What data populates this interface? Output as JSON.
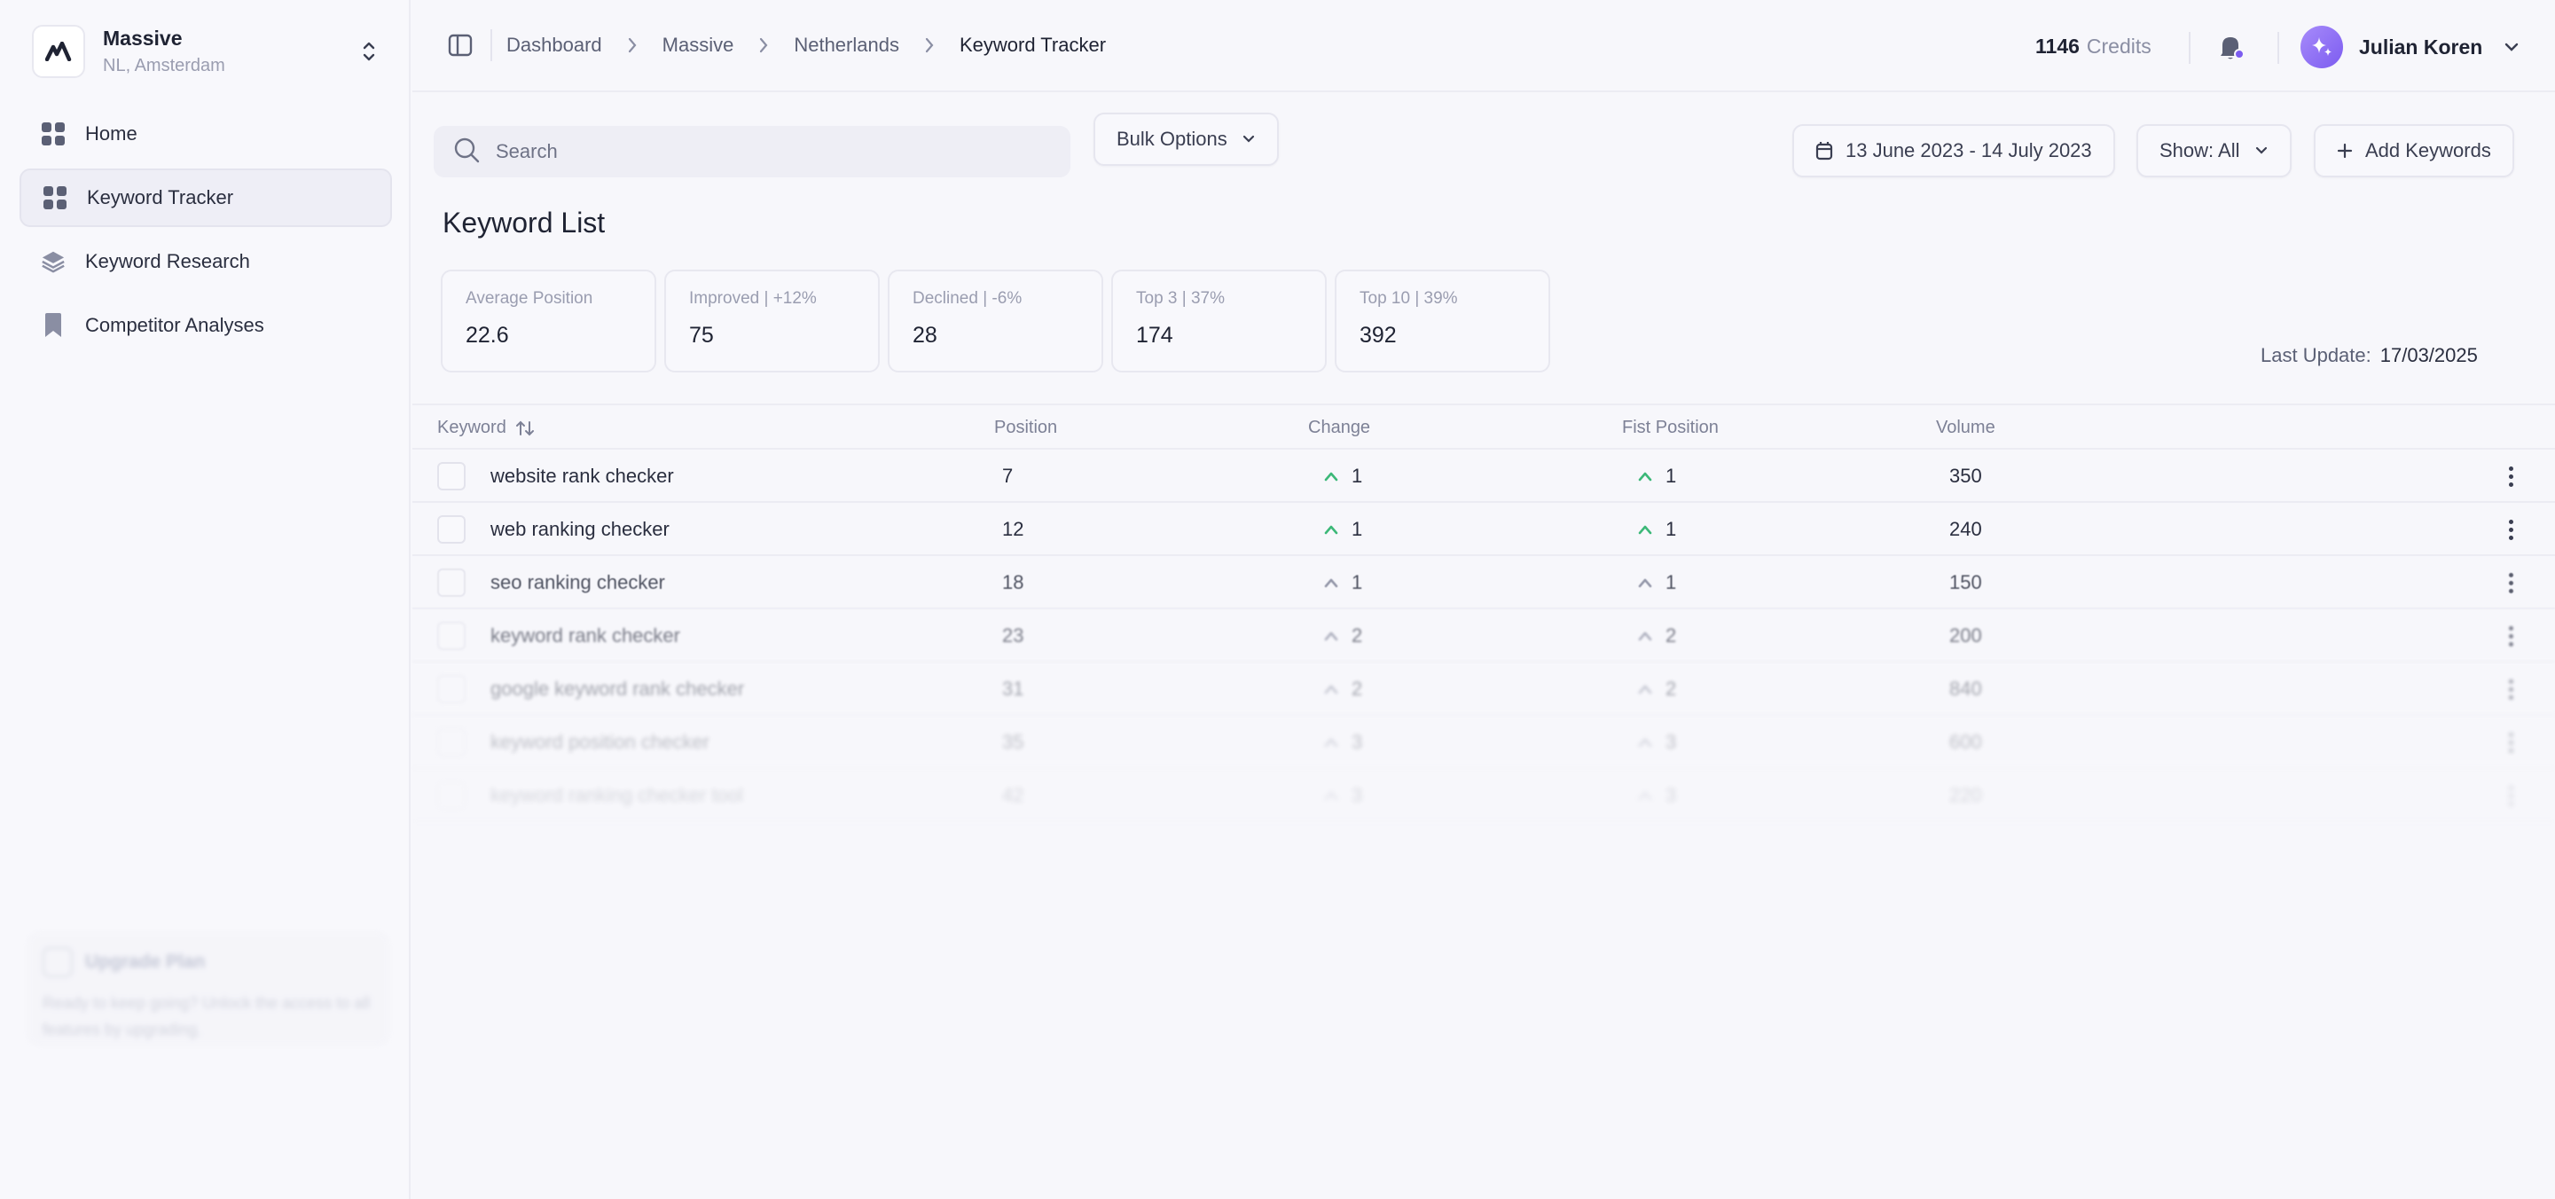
{
  "workspace": {
    "name": "Massive",
    "location": "NL, Amsterdam"
  },
  "nav": [
    {
      "label": "Home",
      "icon": "grid-icon"
    },
    {
      "label": "Keyword Tracker",
      "icon": "grid-icon",
      "active": true
    },
    {
      "label": "Keyword Research",
      "icon": "layers-icon"
    },
    {
      "label": "Competitor Analyses",
      "icon": "bookmark-icon"
    }
  ],
  "breadcrumbs": [
    "Dashboard",
    "Massive",
    "Netherlands",
    "Keyword Tracker"
  ],
  "header": {
    "credits_value": "1146",
    "credits_label": "Credits",
    "user_name": "Julian Koren"
  },
  "toolbar": {
    "search_placeholder": "Search",
    "bulk_label": "Bulk Options",
    "date_range": "13 June 2023 - 14 July 2023",
    "show_label": "Show: All",
    "add_label": "Add Keywords"
  },
  "title": "Keyword List",
  "stats": [
    {
      "label": "Average Position",
      "value": "22.6"
    },
    {
      "label": "Improved | +12%",
      "value": "75"
    },
    {
      "label": "Declined | -6%",
      "value": "28"
    },
    {
      "label": "Top 3 | 37%",
      "value": "174"
    },
    {
      "label": "Top 10 | 39%",
      "value": "392"
    }
  ],
  "last_update": {
    "label": "Last Update:",
    "value": "17/03/2025"
  },
  "table": {
    "columns": [
      "Keyword",
      "Position",
      "Change",
      "Fist Position",
      "Volume"
    ],
    "rows": [
      {
        "keyword": "website rank checker",
        "position": "7",
        "change": "1",
        "first": "1",
        "volume": "350"
      },
      {
        "keyword": "web ranking checker",
        "position": "12",
        "change": "1",
        "first": "1",
        "volume": "240"
      },
      {
        "keyword": "seo ranking checker",
        "position": "18",
        "change": "1",
        "first": "1",
        "volume": "150"
      },
      {
        "keyword": "keyword rank checker",
        "position": "23",
        "change": "2",
        "first": "2",
        "volume": "200"
      },
      {
        "keyword": "google keyword rank checker",
        "position": "31",
        "change": "2",
        "first": "2",
        "volume": "840"
      },
      {
        "keyword": "keyword position checker",
        "position": "35",
        "change": "3",
        "first": "3",
        "volume": "600"
      },
      {
        "keyword": "keyword ranking checker tool",
        "position": "42",
        "change": "3",
        "first": "3",
        "volume": "220"
      }
    ]
  },
  "colors": {
    "accent": "#7c5cf0",
    "up_green": "#3cb878",
    "notification_dot": "#7c5cf0"
  }
}
